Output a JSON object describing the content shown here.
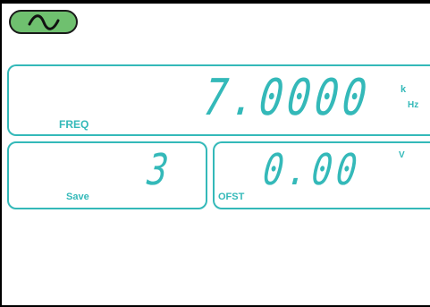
{
  "waveform": {
    "icon": "sine-wave-icon",
    "color": "#6fc06f"
  },
  "accent": "#34b9b9",
  "freq": {
    "label": "FREQ",
    "value": "7.0000",
    "unit_prefix": "k",
    "unit": "Hz"
  },
  "save": {
    "label": "Save",
    "value": "3"
  },
  "offset": {
    "label": "OFST",
    "value": "0.00",
    "unit": "V"
  }
}
